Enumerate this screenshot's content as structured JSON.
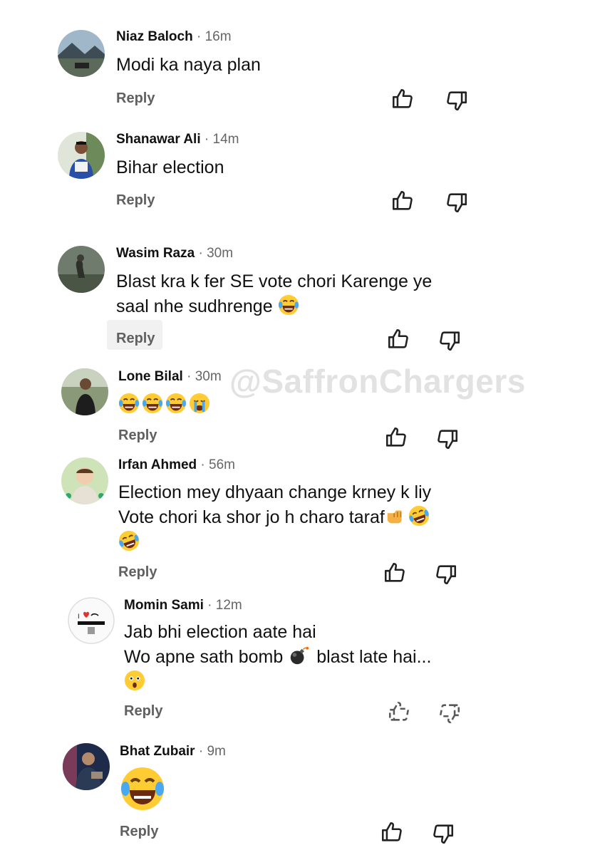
{
  "watermark": "@SaffronChargers",
  "reply_label": "Reply",
  "comments": [
    {
      "name": "Niaz Baloch",
      "time": "16m",
      "lines": [
        "Modi ka naya plan"
      ],
      "emojis": []
    },
    {
      "name": "Shanawar Ali",
      "time": "14m",
      "lines": [
        "Bihar election"
      ],
      "emojis": []
    },
    {
      "name": "Wasim Raza",
      "time": "30m",
      "lines": [
        "Blast kra k fer SE vote chori Karenge ye",
        "saal nhe sudhrenge"
      ],
      "emojis": [
        "tears-of-joy"
      ]
    },
    {
      "name": "Lone Bilal",
      "time": "30m",
      "lines": [
        ""
      ],
      "emojis": [
        "tears-of-joy",
        "tears-of-joy",
        "tears-of-joy",
        "crying"
      ]
    },
    {
      "name": "Irfan Ahmed",
      "time": "56m",
      "lines": [
        "Election mey dhyaan change krney k liy",
        "Vote chori ka shor jo h charo taraf"
      ],
      "emojis": [
        "fist-bump",
        "tears-of-joy",
        "tears-of-joy"
      ]
    },
    {
      "name": "Momin Sami",
      "time": "12m",
      "lines": [
        "Jab bhi election aate hai",
        "Wo apne sath bomb",
        "blast late hai..."
      ],
      "emojis": [
        "bomb",
        "astonished"
      ]
    },
    {
      "name": "Bhat Zubair",
      "time": "9m",
      "lines": [
        ""
      ],
      "emojis": [
        "tears-of-joy"
      ]
    }
  ]
}
